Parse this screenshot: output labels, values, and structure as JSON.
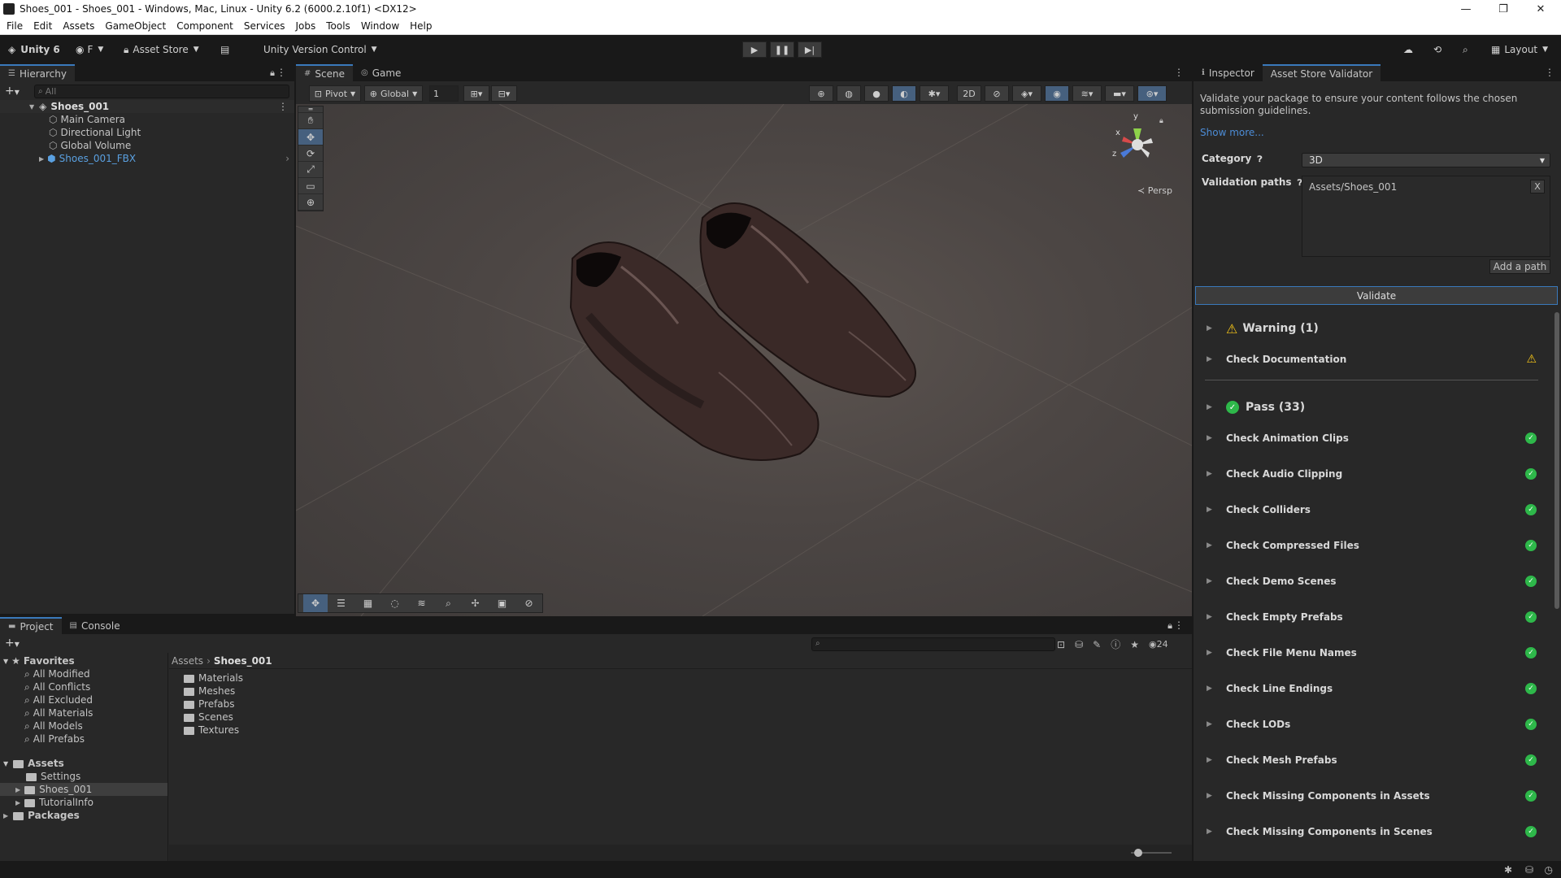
{
  "window": {
    "title": "Shoes_001 - Shoes_001 - Windows, Mac, Linux - Unity 6.2 (6000.2.10f1) <DX12>",
    "controls": [
      "—",
      "❐",
      "✕"
    ]
  },
  "menu": [
    "File",
    "Edit",
    "Assets",
    "GameObject",
    "Component",
    "Services",
    "Jobs",
    "Tools",
    "Window",
    "Help"
  ],
  "toolbar": {
    "unity_label": "Unity 6",
    "account_label": "F",
    "asset_store_label": "Asset Store",
    "version_control_label": "Unity Version Control",
    "layout_label": "Layout"
  },
  "hierarchy": {
    "tab_label": "Hierarchy",
    "search_placeholder": "All",
    "scene": "Shoes_001",
    "items": [
      "Main Camera",
      "Directional Light",
      "Global Volume",
      "Shoes_001_FBX"
    ]
  },
  "scene_tabs": {
    "scene": "Scene",
    "game": "Game"
  },
  "scene_toolbar": {
    "pivot": "Pivot",
    "global": "Global",
    "grid_value": "1"
  },
  "gizmo": {
    "y": "y",
    "x": "x",
    "z": "z",
    "persp": "≺ Persp"
  },
  "inspector": {
    "tab_inspector": "Inspector",
    "tab_validator": "Asset Store Validator",
    "description": "Validate your package to ensure your content follows the chosen submission guidelines.",
    "show_more": "Show more...",
    "category_label": "Category",
    "category_value": "3D",
    "validation_paths_label": "Validation paths",
    "validation_path": "Assets/Shoes_001",
    "remove_path": "X",
    "add_path": "Add a path",
    "validate_button": "Validate",
    "warning_group": "Warning (1)",
    "warning_items": [
      "Check Documentation"
    ],
    "pass_group": "Pass (33)",
    "pass_items": [
      "Check Animation Clips",
      "Check Audio Clipping",
      "Check Colliders",
      "Check Compressed Files",
      "Check Demo Scenes",
      "Check Empty Prefabs",
      "Check File Menu Names",
      "Check Line Endings",
      "Check LODs",
      "Check Mesh Prefabs",
      "Check Missing Components in Assets",
      "Check Missing Components in Scenes"
    ]
  },
  "project": {
    "tab_project": "Project",
    "tab_console": "Console",
    "favorites_label": "Favorites",
    "favorites": [
      "All Modified",
      "All Conflicts",
      "All Excluded",
      "All Materials",
      "All Models",
      "All Prefabs"
    ],
    "assets_label": "Assets",
    "asset_tree": [
      "Settings",
      "Shoes_001",
      "TutorialInfo"
    ],
    "packages_label": "Packages",
    "breadcrumb_root": "Assets",
    "breadcrumb_current": "Shoes_001",
    "folders": [
      "Materials",
      "Meshes",
      "Prefabs",
      "Scenes",
      "Textures"
    ],
    "hidden_count": "24"
  },
  "colors": {
    "accent_blue": "#3a79bb",
    "pass_green": "#2eb84a",
    "warning_yellow": "#f5c518",
    "panel_bg": "#282828"
  }
}
